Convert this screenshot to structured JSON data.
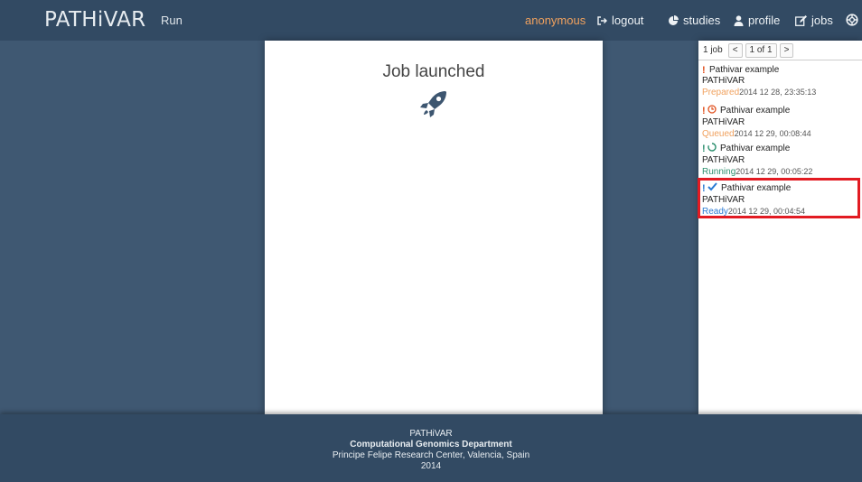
{
  "header": {
    "brand": "PATHiVAR",
    "run_label": "Run",
    "user": "anonymous",
    "logout": "logout",
    "studies": "studies",
    "profile": "profile",
    "jobs": "jobs"
  },
  "main": {
    "title": "Job launched",
    "icon": "rocket-icon"
  },
  "jobs_panel": {
    "count_label": "1 job",
    "prev": "<",
    "page": "1 of 1",
    "next": ">",
    "items": [
      {
        "name": "Pathivar example",
        "tool": "PATHiVAR",
        "status": "Prepared",
        "timestamp": "2014 12 28, 23:35:13",
        "status_icon": "none"
      },
      {
        "name": "Pathivar example",
        "tool": "PATHiVAR",
        "status": "Queued",
        "timestamp": "2014 12 29, 00:08:44",
        "status_icon": "clock-icon"
      },
      {
        "name": "Pathivar example",
        "tool": "PATHiVAR",
        "status": "Running",
        "timestamp": "2014 12 29, 00:05:22",
        "status_icon": "spinner-icon"
      },
      {
        "name": "Pathivar example",
        "tool": "PATHiVAR",
        "status": "Ready",
        "timestamp": "2014 12 29, 00:04:54",
        "status_icon": "check-icon"
      }
    ]
  },
  "footer": {
    "line1": "PATHiVAR",
    "line2": "Computational Genomics Department",
    "line3": "Principe Felipe Research Center, Valencia, Spain",
    "line4": "2014"
  },
  "colors": {
    "header_bg": "#324a63",
    "page_bg": "#3f5872",
    "accent_user": "#f0a15e",
    "status_ready": "#2a7ad3",
    "status_running": "#2c8f6e",
    "highlight": "#e21b22"
  }
}
